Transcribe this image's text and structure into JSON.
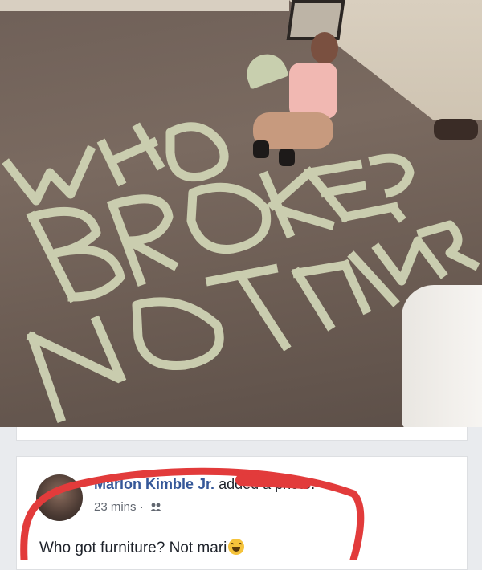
{
  "photo": {
    "description_icon": "photo-image",
    "bill_rows": [
      [
        "W",
        "H",
        "O"
      ],
      [
        "B",
        "R",
        "O",
        "K",
        "E",
        "?"
      ],
      [
        "N",
        "O",
        "T",
        "M",
        "A",
        "R",
        "I"
      ]
    ]
  },
  "post": {
    "author": "Marlon Kimble Jr.",
    "action": "added a photo.",
    "time": "23 mins",
    "separator": "·",
    "privacy_icon": "friends-icon",
    "text": "Who got furniture? Not mari",
    "emoji_icon": "laughing-crying-emoji-icon"
  },
  "colors": {
    "link": "#365899",
    "text": "#1d2129",
    "meta": "#616770",
    "highlight": "#e23b3b"
  }
}
